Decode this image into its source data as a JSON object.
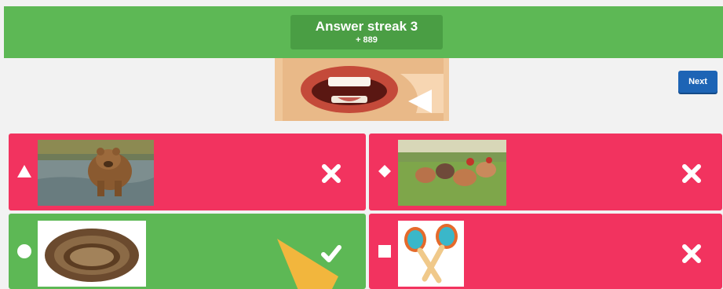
{
  "header": {
    "streak_title": "Answer streak 3",
    "streak_points": "+ 889"
  },
  "question": {
    "image_icon": "mouth-teeth-image"
  },
  "next_button": {
    "label": "Next"
  },
  "answers": [
    {
      "shape": "triangle",
      "image": "bear-in-water",
      "status": "wrong",
      "mark_icon": "cross-icon",
      "color": "#f2335f"
    },
    {
      "shape": "diamond",
      "image": "chickens-in-field",
      "status": "wrong",
      "mark_icon": "cross-icon",
      "color": "#f2335f"
    },
    {
      "shape": "circle",
      "image": "bird-nest",
      "status": "correct",
      "mark_icon": "check-icon",
      "color": "#5db855"
    },
    {
      "shape": "square",
      "image": "maracas",
      "status": "wrong",
      "mark_icon": "cross-icon",
      "color": "#f2335f"
    }
  ],
  "colors": {
    "green": "#5db855",
    "red": "#f2335f",
    "blue": "#1d64b5"
  }
}
